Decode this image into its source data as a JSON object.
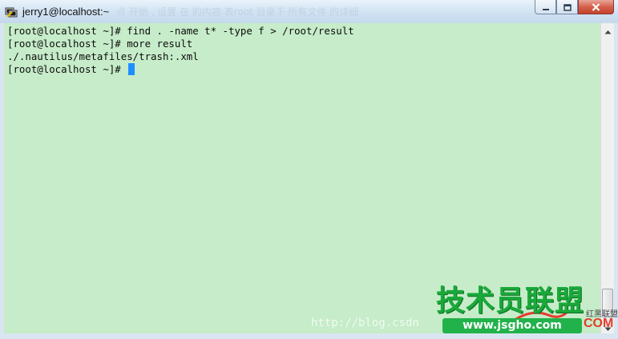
{
  "window": {
    "title": "jerry1@localhost:~",
    "background_text": "点 开始 , 设置 在 的内容 表root 目录下 所有文件 的详细"
  },
  "terminal": {
    "background_color": "#c6ecc9",
    "cursor_color": "#1e8fff",
    "lines": [
      "[root@localhost ~]# find . -name t* -type f > /root/result",
      "[root@localhost ~]# more result",
      "./.nautilus/metafiles/trash:.xml",
      "[root@localhost ~]# "
    ]
  },
  "watermark": {
    "url": "http://blog.csdn",
    "logo": "技术员联盟",
    "site": "www.jsgho.com",
    "com": "COM",
    "small": "红黑联盟"
  },
  "icons": {
    "app": "putty-terminal-icon",
    "minimize": "minimize-icon",
    "maximize": "maximize-icon",
    "close": "close-icon",
    "scroll_up": "scroll-up-arrow-icon",
    "scroll_down": "scroll-down-arrow-icon"
  }
}
